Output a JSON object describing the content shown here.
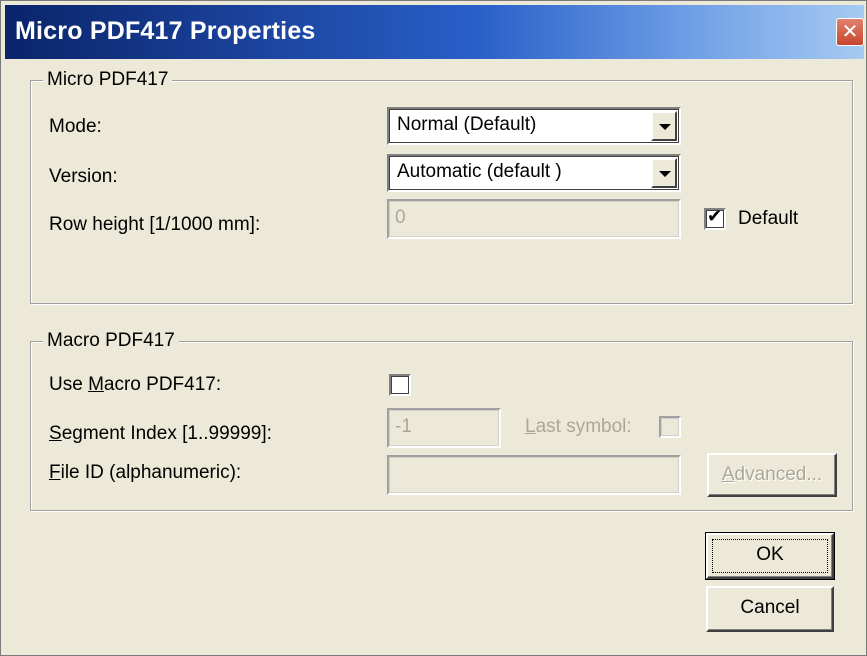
{
  "window": {
    "title": "Micro PDF417 Properties",
    "close_glyph": "✕"
  },
  "micro_group": {
    "title": "Micro PDF417",
    "mode_label": "Mode:",
    "mode_value": "Normal (Default)",
    "version_label": "Version:",
    "version_value": "Automatic (default )",
    "row_height_label": "Row height [1/1000 mm]:",
    "row_height_value": "0",
    "default_checkbox_label": "Default",
    "default_checked": true
  },
  "macro_group": {
    "title": "Macro PDF417",
    "use_macro_label_pre": "Use ",
    "use_macro_label_accel": "M",
    "use_macro_label_post": "acro PDF417:",
    "use_macro_checked": false,
    "segment_index_label_accel": "S",
    "segment_index_label_post": "egment Index [1..99999]:",
    "segment_index_value": "-1",
    "last_symbol_label_accel": "L",
    "last_symbol_label_post": "ast symbol:",
    "last_symbol_checked": false,
    "file_id_label_accel": "F",
    "file_id_label_post": "ile ID (alphanumeric):",
    "file_id_value": "",
    "advanced_label_accel": "A",
    "advanced_label_post": "dvanced..."
  },
  "buttons": {
    "ok_label": "OK",
    "cancel_label": "Cancel"
  },
  "icons": {
    "close": "close-icon",
    "dropdown": "chevron-down-icon",
    "check": "checkmark-icon"
  },
  "colors": {
    "dialog_bg": "#ece9d8",
    "titlebar_start": "#0a246a",
    "titlebar_end": "#a6caf0",
    "disabled_text": "#aca899",
    "close_button": "#c8452f"
  }
}
